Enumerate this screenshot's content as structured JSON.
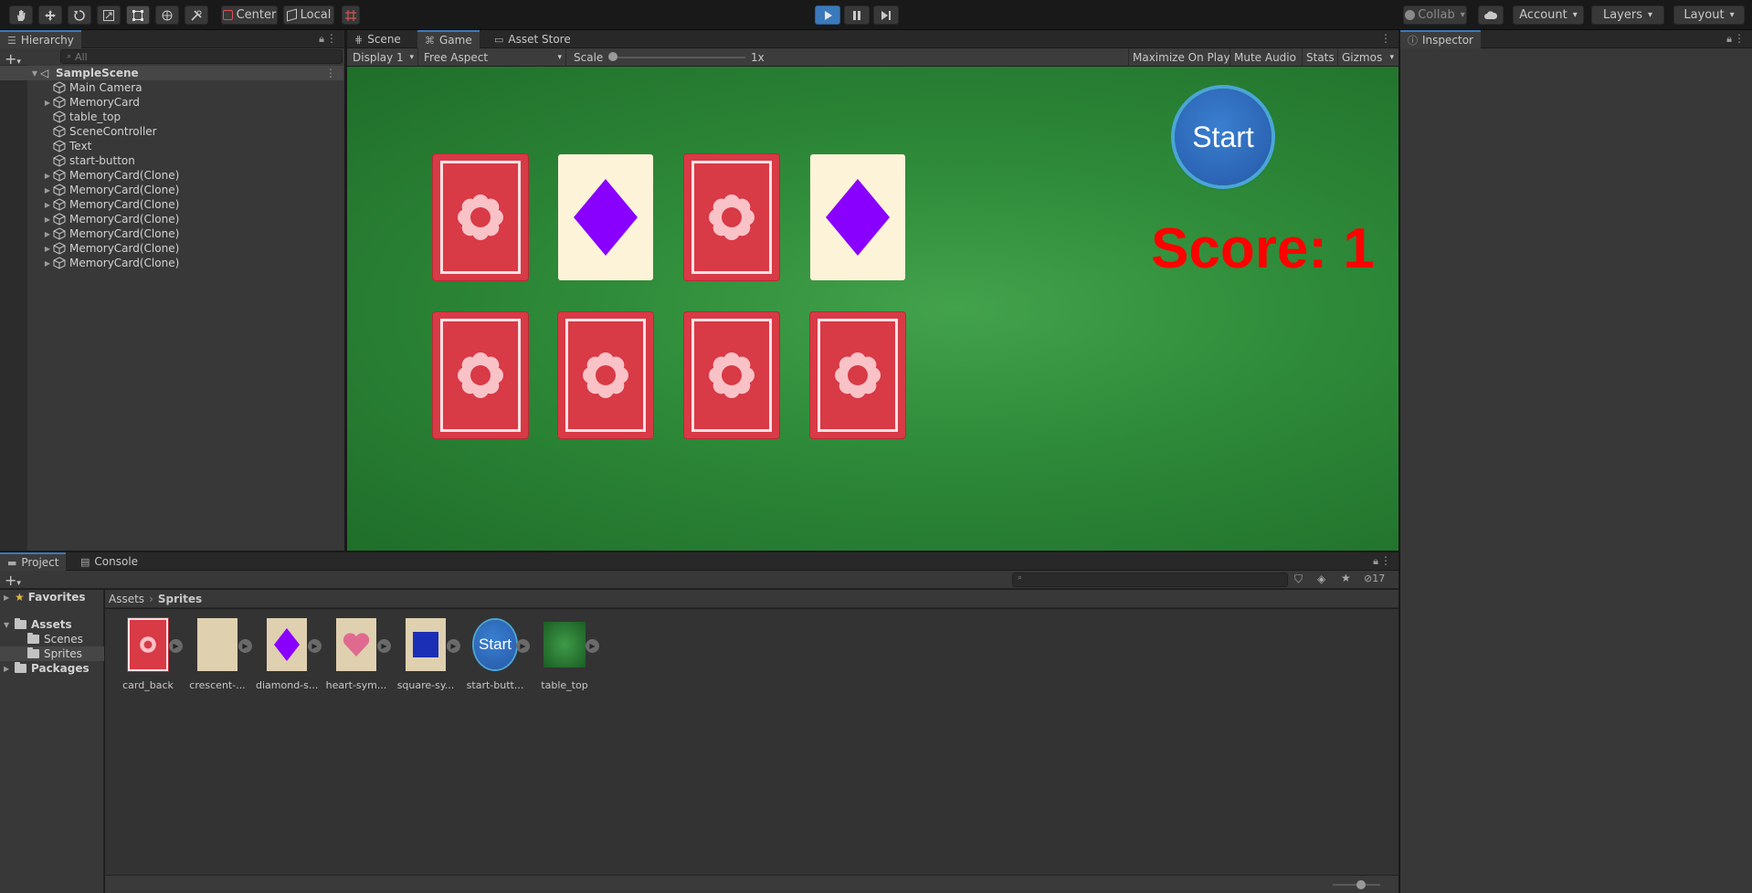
{
  "toolbar": {
    "pivot_label": "Center",
    "space_label": "Local",
    "collab_label": "Collab",
    "account_label": "Account",
    "layers_label": "Layers",
    "layout_label": "Layout",
    "tools": [
      "hand-tool-icon",
      "move-tool-icon",
      "rotate-tool-icon",
      "scale-tool-icon",
      "rect-tool-icon",
      "transform-tool-icon",
      "custom-tool-icon"
    ]
  },
  "hierarchy": {
    "tab_label": "Hierarchy",
    "search_placeholder": "All",
    "scene_name": "SampleScene",
    "items": [
      {
        "label": "Main Camera",
        "expandable": false
      },
      {
        "label": "MemoryCard",
        "expandable": true
      },
      {
        "label": "table_top",
        "expandable": false
      },
      {
        "label": "SceneController",
        "expandable": false
      },
      {
        "label": "Text",
        "expandable": false
      },
      {
        "label": "start-button",
        "expandable": false
      },
      {
        "label": "MemoryCard(Clone)",
        "expandable": true
      },
      {
        "label": "MemoryCard(Clone)",
        "expandable": true
      },
      {
        "label": "MemoryCard(Clone)",
        "expandable": true
      },
      {
        "label": "MemoryCard(Clone)",
        "expandable": true
      },
      {
        "label": "MemoryCard(Clone)",
        "expandable": true
      },
      {
        "label": "MemoryCard(Clone)",
        "expandable": true
      },
      {
        "label": "MemoryCard(Clone)",
        "expandable": true
      }
    ]
  },
  "center_tabs": {
    "scene": "Scene",
    "game": "Game",
    "asset_store": "Asset Store"
  },
  "game_toolbar": {
    "display": "Display 1",
    "aspect": "Free Aspect",
    "scale_label": "Scale",
    "scale_value": "1x",
    "maximize": "Maximize On Play",
    "mute": "Mute Audio",
    "stats": "Stats",
    "gizmos": "Gizmos"
  },
  "game_view": {
    "start_button_label": "Start",
    "score_text": "Score: 1",
    "cards": [
      {
        "state": "back"
      },
      {
        "state": "face",
        "symbol": "diamond"
      },
      {
        "state": "back"
      },
      {
        "state": "face",
        "symbol": "diamond"
      },
      {
        "state": "back"
      },
      {
        "state": "back"
      },
      {
        "state": "back"
      },
      {
        "state": "back"
      }
    ],
    "colors": {
      "table": "#2f8c3a",
      "card_back": "#d83a46",
      "card_face": "#fdf3d8",
      "diamond": "#8a00ff",
      "score": "#ff0000",
      "start": "#2b66b8"
    }
  },
  "inspector": {
    "tab_label": "Inspector"
  },
  "project": {
    "tab_label": "Project",
    "console_label": "Console",
    "hidden_count": "17",
    "favorites_label": "Favorites",
    "assets_label": "Assets",
    "scenes_label": "Scenes",
    "sprites_label": "Sprites",
    "packages_label": "Packages",
    "breadcrumb": [
      "Assets",
      "Sprites"
    ],
    "assets": [
      {
        "label": "card_back"
      },
      {
        "label": "crescent-..."
      },
      {
        "label": "diamond-s..."
      },
      {
        "label": "heart-sym..."
      },
      {
        "label": "square-sy..."
      },
      {
        "label": "start-butt..."
      },
      {
        "label": "table_top"
      }
    ],
    "start_thumb_text": "Start"
  }
}
